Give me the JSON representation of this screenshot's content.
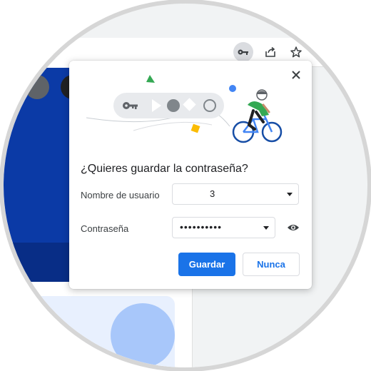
{
  "dialog": {
    "title": "¿Quieres guardar la contraseña?",
    "username_label": "Nombre de usuario",
    "username_value": "3",
    "password_label": "Contraseña",
    "password_value": "••••••••••",
    "save_label": "Guardar",
    "never_label": "Nunca"
  },
  "icons": {
    "toolbar": [
      "key-icon",
      "share-icon",
      "star-icon"
    ],
    "dialog": [
      "close-icon",
      "eye-icon",
      "chevron-down-icon"
    ]
  },
  "colors": {
    "primary": "#1a73e8",
    "dark_blue_panel": "#0b3aa6",
    "key_button_bg": "#dadce0"
  }
}
